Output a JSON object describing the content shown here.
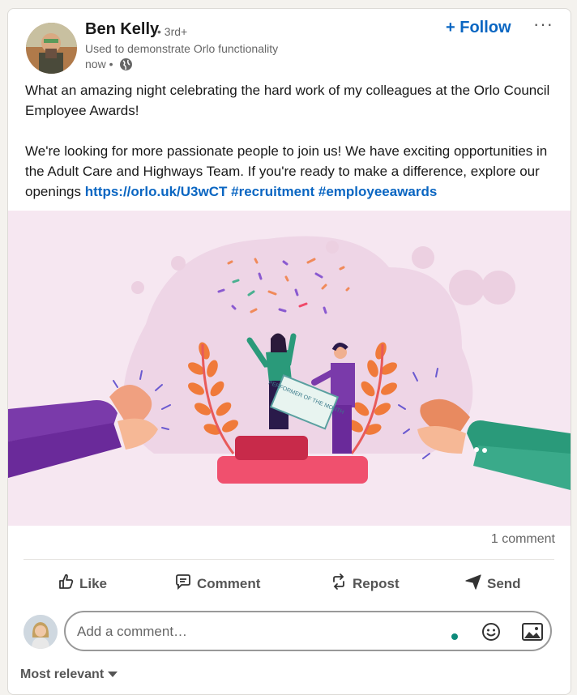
{
  "post": {
    "author": {
      "name": "Ben Kelly",
      "degree": "• 3rd+",
      "headline": "Used to demonstrate Orlo functionality",
      "time": "now •"
    },
    "follow_label": "+ Follow",
    "more_label": "···",
    "text_para1": "What an amazing night celebrating the hard work of my colleagues at the Orlo Council Employee Awards!",
    "text_para2": " We're looking for more passionate people to join us! We have exciting opportunities in the Adult Care and Highways Team. If you're ready to make a difference, explore our openings ",
    "link_url": "https://orlo.uk/U3wCT",
    "hashtag1": "#recruitment",
    "hashtag2": "#employeeawards",
    "image": {
      "certificate_text": "PERFORMER OF THE MONTH"
    },
    "comments_count": "1 comment"
  },
  "actions": {
    "like": "Like",
    "comment": "Comment",
    "repost": "Repost",
    "send": "Send"
  },
  "comment_input": {
    "placeholder": "Add a comment…"
  },
  "sort_label": "Most relevant",
  "icons": [
    "globe-icon",
    "like-icon",
    "comment-icon",
    "repost-icon",
    "send-icon",
    "emoji-icon",
    "image-icon",
    "chevron-down-icon"
  ],
  "colors": {
    "link": "#0a66c2",
    "image_bg": "#f6e7f1",
    "status_dot": "#0d8a7a"
  }
}
